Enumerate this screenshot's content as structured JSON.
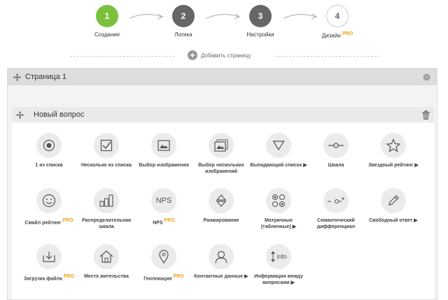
{
  "steps": [
    {
      "num": "1",
      "label": "Создание"
    },
    {
      "num": "2",
      "label": "Логика"
    },
    {
      "num": "3",
      "label": "Настройки"
    },
    {
      "num": "4",
      "label": "Дизайн",
      "badge": "PRO"
    }
  ],
  "add_page": {
    "label": "Добавить страницу"
  },
  "page": {
    "title": "Страница 1"
  },
  "question": {
    "title": "Новый вопрос"
  },
  "types": [
    {
      "label": "1 из списка",
      "icon": "radio-icon"
    },
    {
      "label": "Несколько из списка",
      "icon": "checkbox-icon"
    },
    {
      "label": "Выбор изображения",
      "icon": "image-icon"
    },
    {
      "label": "Выбор нескольких изображений",
      "icon": "images-icon"
    },
    {
      "label": "Выпадающий список ▶",
      "icon": "dropdown-icon"
    },
    {
      "label": "Шкала",
      "icon": "slider-icon"
    },
    {
      "label": "Звездный рейтинг ▶",
      "icon": "star-icon"
    },
    {
      "label": "Смайл рейтинг",
      "badge": "PRO",
      "icon": "smiley-icon"
    },
    {
      "label": "Распределительная шкала",
      "icon": "bars-icon"
    },
    {
      "label": "NPS",
      "badge": "PRO",
      "icon": "nps-icon",
      "icon_text": "NPS"
    },
    {
      "label": "Ранжирование",
      "icon": "ranking-icon"
    },
    {
      "label": "Матричные (табличные) ▶",
      "icon": "matrix-icon"
    },
    {
      "label": "Семантический дифференциал",
      "icon": "semantic-icon"
    },
    {
      "label": "Свободный ответ ▶",
      "icon": "pencil-icon"
    },
    {
      "label": "Загрузка файла",
      "badge": "PRO",
      "icon": "upload-icon"
    },
    {
      "label": "Место жительства",
      "icon": "home-icon"
    },
    {
      "label": "Геолокация",
      "badge": "PRO",
      "icon": "location-icon"
    },
    {
      "label": "Контактные данные ▶",
      "icon": "person-icon"
    },
    {
      "label": "Информация между вопросами ▶",
      "icon": "info-icon",
      "icon_text": "info"
    }
  ],
  "colors": {
    "active": "#7cc13c",
    "pro": "#f39c12",
    "dark_step": "#666666"
  }
}
